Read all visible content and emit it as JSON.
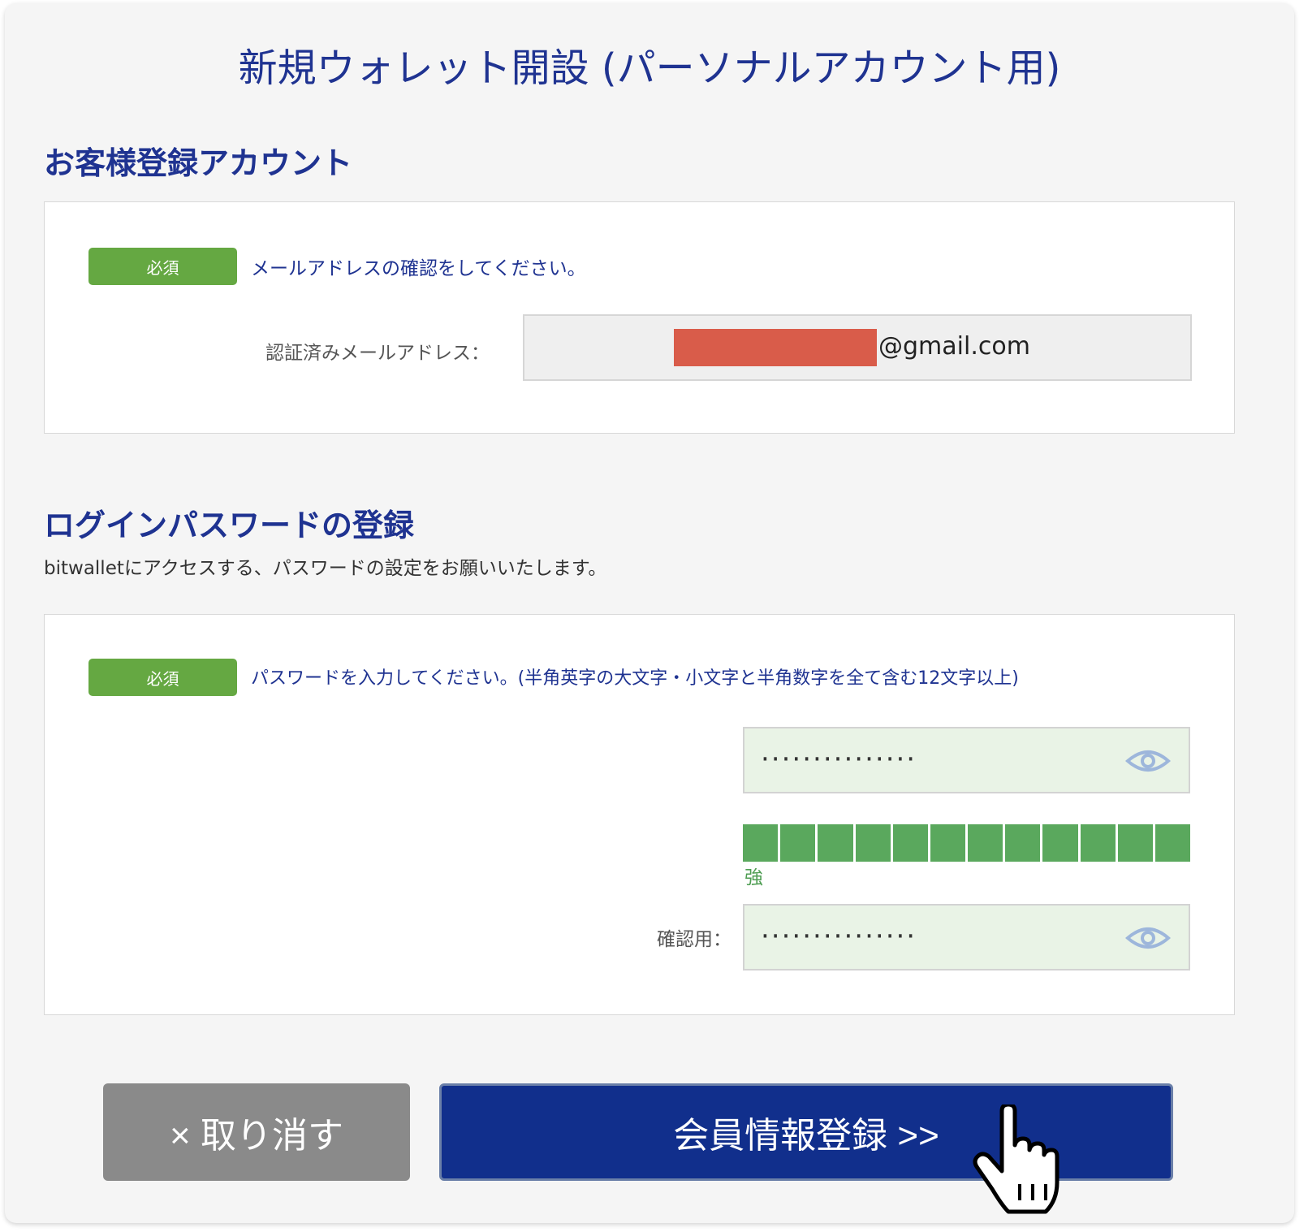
{
  "page": {
    "title": "新規ウォレット開設 (パーソナルアカウント用)"
  },
  "account_section": {
    "heading": "お客様登録アカウント",
    "badge": "必須",
    "instruction": "メールアドレスの確認をしてください。",
    "email_label": "認証済みメールアドレス：",
    "email_domain": "@gmail.com",
    "redaction_color": "#d95c4a"
  },
  "password_section": {
    "heading": "ログインパスワードの登録",
    "description": "bitwalletにアクセスする、パスワードの設定をお願いいたします。",
    "badge": "必須",
    "instruction": "パスワードを入力してください。(半角英字の大文字・小文字と半角数字を全て含む12文字以上)",
    "password_value": "···············",
    "strength_label": "強",
    "strength_fraction": 1.0,
    "strength_segments": 12,
    "confirm_label": "確認用：",
    "confirm_value": "···············",
    "eye_icon": "eye-icon"
  },
  "actions": {
    "cancel_label": "× 取り消す",
    "submit_label": "会員情報登録 >>"
  },
  "colors": {
    "primary": "#1f3391",
    "badge_green": "#65a842",
    "meter_green": "#5aa85d",
    "button_blue": "#112f8c",
    "button_gray": "#8a8a8a"
  }
}
